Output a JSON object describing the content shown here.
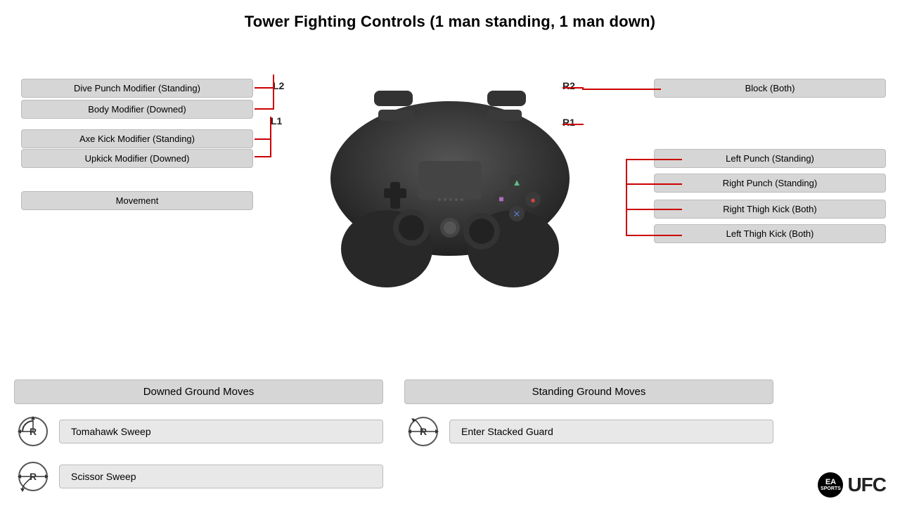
{
  "title": "Tower Fighting Controls (1 man standing, 1 man down)",
  "left_labels": {
    "l2_top": "Dive Punch Modifier (Standing)",
    "l2_bottom": "Body Modifier (Downed)",
    "l1_top": "Axe Kick Modifier (Standing)",
    "l1_bottom": "Upkick Modifier (Downed)",
    "movement": "Movement",
    "l2": "L2",
    "l1": "L1"
  },
  "right_labels": {
    "r2": "R2",
    "r1": "R1",
    "block": "Block (Both)",
    "left_punch": "Left Punch (Standing)",
    "right_punch": "Right Punch (Standing)",
    "right_thigh": "Right Thigh Kick (Both)",
    "left_thigh": "Left Thigh Kick (Both)"
  },
  "downed_section": {
    "title": "Downed Ground Moves",
    "moves": [
      {
        "label": "Tomahawk Sweep",
        "direction": "rotate-left"
      },
      {
        "label": "Scissor Sweep",
        "direction": "rotate-right"
      }
    ]
  },
  "standing_section": {
    "title": "Standing Ground Moves",
    "moves": [
      {
        "label": "Enter Stacked Guard",
        "direction": "rotate-up"
      }
    ]
  },
  "logos": {
    "ea_line1": "EA",
    "ea_line2": "SPORTS",
    "ufc": "UFC"
  }
}
